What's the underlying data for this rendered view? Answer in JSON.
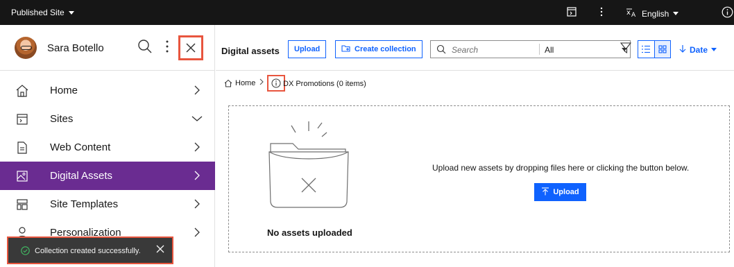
{
  "topbar": {
    "site_label": "Published Site",
    "language": "English",
    "icons": [
      "site-panel-icon",
      "more-vertical-icon",
      "translate-icon",
      "info-icon"
    ]
  },
  "sidebar": {
    "user_name": "Sara Botello",
    "items": [
      {
        "label": "Home",
        "icon": "home-icon",
        "chevron": "right"
      },
      {
        "label": "Sites",
        "icon": "sites-icon",
        "chevron": "down"
      },
      {
        "label": "Web Content",
        "icon": "document-icon",
        "chevron": "right"
      },
      {
        "label": "Digital Assets",
        "icon": "image-icon",
        "chevron": "right",
        "active": true
      },
      {
        "label": "Site Templates",
        "icon": "template-icon",
        "chevron": "right"
      },
      {
        "label": "Personalization",
        "icon": "person-icon",
        "chevron": "right"
      }
    ]
  },
  "toast": {
    "message": "Collection created successfully."
  },
  "toolbar": {
    "title": "Digital assets",
    "upload_label": "Upload",
    "create_collection_label": "Create collection",
    "search_placeholder": "Search",
    "search_scope": "All",
    "sort_label": "Date"
  },
  "breadcrumb": {
    "home": "Home",
    "current": "DX Promotions (0 items)"
  },
  "dropzone": {
    "empty_title": "No assets uploaded",
    "message": "Upload new assets by dropping files here or clicking the button below.",
    "upload_label": "Upload"
  },
  "colors": {
    "accent": "#0f62fe",
    "nav_active": "#6a2c91",
    "highlight": "#e8553e",
    "topbar": "#161616"
  }
}
